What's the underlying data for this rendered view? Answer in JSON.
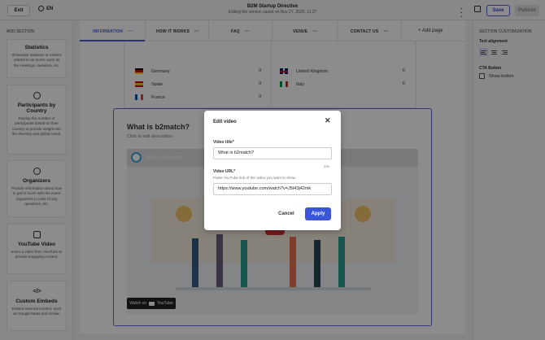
{
  "topbar": {
    "exit_label": "Exit",
    "lang": "EN",
    "title": "B2M Startup Directive",
    "subtitle": "Editing the version saved on Nov 27, 2025, 11:27",
    "save_label": "Save",
    "publish_label": "Publish"
  },
  "left_panel": {
    "heading": "ADD SECTION",
    "cards": [
      {
        "title": "Statistics",
        "desc": "Showcase statistics or metrics related to an event, such as the meetings, sessions, etc.",
        "icon": "chart-icon"
      },
      {
        "title": "Participants by Country",
        "desc": "Display the number of participants based on their country to provide insight into the diversity and global reach.",
        "icon": "globe-icon"
      },
      {
        "title": "Organizers",
        "desc": "Provide information about how to get in touch with the event organizers in case of any questions, etc.",
        "icon": "people-icon"
      },
      {
        "title": "YouTube Video",
        "desc": "Insert a video from YouTube to provide engaging content.",
        "icon": "youtube-icon"
      },
      {
        "title": "Custom Embeds",
        "desc": "Embed external content, such as Google Maps and similar.",
        "icon": "code-icon"
      }
    ]
  },
  "tabs": [
    {
      "label": "INFORMATION"
    },
    {
      "label": "HOW IT WORKS"
    },
    {
      "label": "FAQ"
    },
    {
      "label": "VENUE"
    },
    {
      "label": "CONTACT US"
    }
  ],
  "add_page_label": "+  Add page",
  "countries": {
    "left": [
      {
        "name": "Germany",
        "value": "0"
      },
      {
        "name": "Spain",
        "value": "0"
      },
      {
        "name": "France",
        "value": "0"
      }
    ],
    "right": [
      {
        "name": "United Kingdom",
        "value": "0"
      },
      {
        "name": "Italy",
        "value": "0"
      }
    ]
  },
  "section": {
    "title": "What is b2match?",
    "desc": "Click to edit description",
    "video_title": "What is b2match?",
    "watch_on": "Watch on",
    "yt_label": "YouTube"
  },
  "right_panel": {
    "heading": "SECTION CUSTOMIZATION",
    "text_alignment_label": "Text alignment",
    "cta_label": "CTA Button",
    "show_button_label": "Show button"
  },
  "modal": {
    "title": "Edit video",
    "video_title_label": "Video title*",
    "video_title_value": "What is b2match?",
    "counter": "239",
    "video_url_label": "Video URL*",
    "video_url_help": "Paste YouTube link of the video you want to show.",
    "video_url_value": "https://www.youtube.com/watch?v=J5t43j42mk",
    "cancel_label": "Cancel",
    "apply_label": "Apply"
  }
}
